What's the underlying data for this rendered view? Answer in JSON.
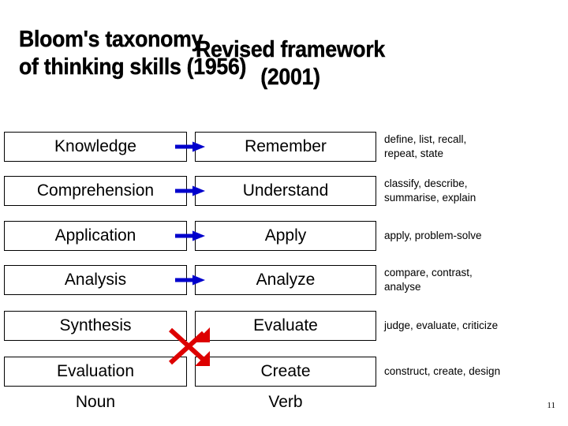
{
  "titles": {
    "left_line1": "Bloom's taxonomy",
    "left_line2": "of thinking skills (1956)",
    "right_line1": "Revised framework",
    "right_line2": "(2001)"
  },
  "colors": {
    "arrow_blue": "#0000CC",
    "arrow_red": "#DD0000",
    "border": "#000000",
    "text": "#000000"
  },
  "columns": {
    "noun_label": "Noun",
    "verb_label": "Verb"
  },
  "rows": [
    {
      "noun": "Knowledge",
      "verb": "Remember",
      "verbs_line1": "define, list, recall,",
      "verbs_line2": "repeat, state",
      "arrow": "straight-blue"
    },
    {
      "noun": "Comprehension",
      "verb": "Understand",
      "verbs_line1": "classify, describe,",
      "verbs_line2": "summarise, explain",
      "arrow": "straight-blue"
    },
    {
      "noun": "Application",
      "verb": "Apply",
      "verbs_line1": "apply, problem-solve",
      "verbs_line2": "",
      "arrow": "straight-blue"
    },
    {
      "noun": "Analysis",
      "verb": "Analyze",
      "verbs_line1": "compare, contrast,",
      "verbs_line2": "analyse",
      "arrow": "straight-blue"
    },
    {
      "noun": "Synthesis",
      "verb": "Evaluate",
      "verbs_line1": "judge, evaluate, criticize",
      "verbs_line2": "",
      "arrow": "crossed-red"
    },
    {
      "noun": "Evaluation",
      "verb": "Create",
      "verbs_line1": "construct, create, design",
      "verbs_line2": "",
      "arrow": "crossed-red"
    }
  ],
  "page_number": "11"
}
